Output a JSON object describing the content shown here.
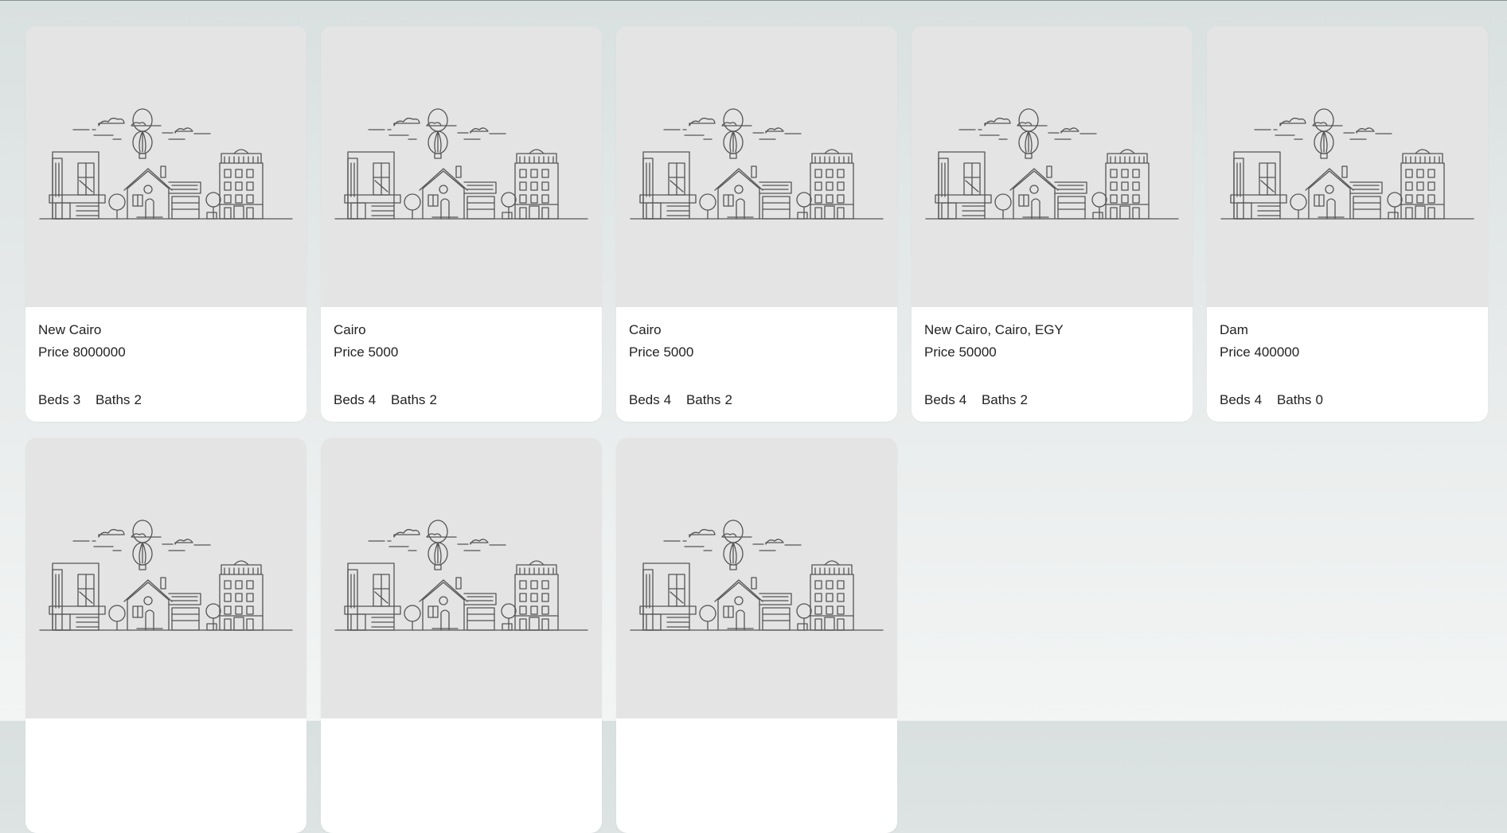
{
  "listings": [
    {
      "location": "New Cairo",
      "price_label": "Price",
      "price": "8000000",
      "beds_label": "Beds",
      "beds": "3",
      "baths_label": "Baths",
      "baths": "2"
    },
    {
      "location": "Cairo",
      "price_label": "Price",
      "price": "5000",
      "beds_label": "Beds",
      "beds": "4",
      "baths_label": "Baths",
      "baths": "2"
    },
    {
      "location": "Cairo",
      "price_label": "Price",
      "price": "5000",
      "beds_label": "Beds",
      "beds": "4",
      "baths_label": "Baths",
      "baths": "2"
    },
    {
      "location": "New Cairo, Cairo, EGY",
      "price_label": "Price",
      "price": "50000",
      "beds_label": "Beds",
      "beds": "4",
      "baths_label": "Baths",
      "baths": "2"
    },
    {
      "location": "Dam",
      "price_label": "Price",
      "price": "400000",
      "beds_label": "Beds",
      "beds": "4",
      "baths_label": "Baths",
      "baths": "0"
    },
    {},
    {},
    {}
  ],
  "placeholder_icon": "house-illustration-icon",
  "colors": {
    "image_background": "#e4e4e4",
    "card_background": "#ffffff",
    "text": "#222222"
  }
}
